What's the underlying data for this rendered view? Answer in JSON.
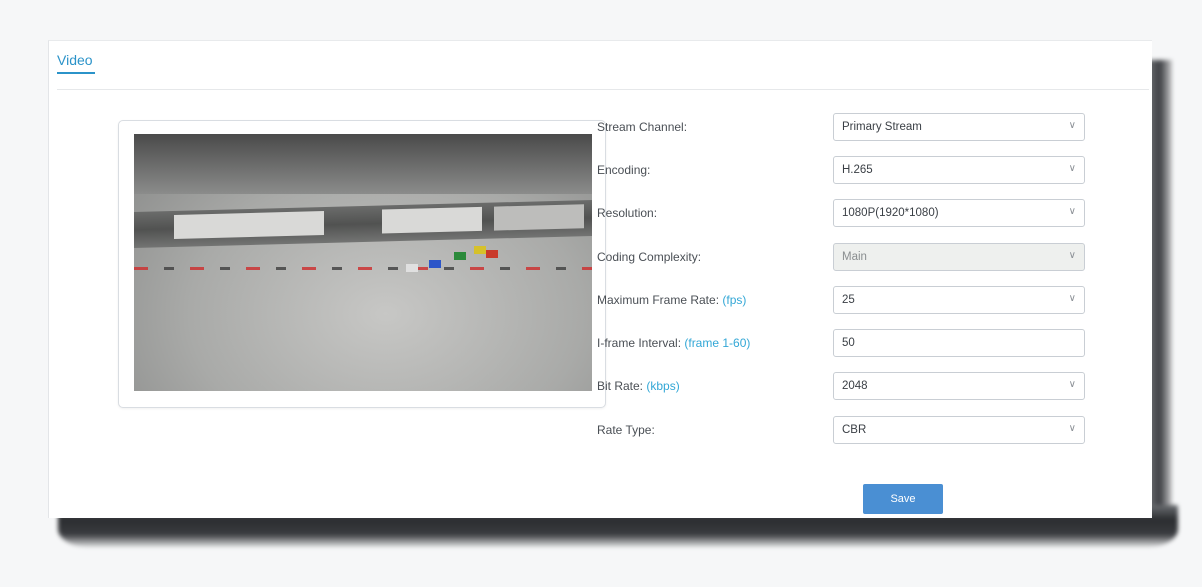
{
  "tab": {
    "title": "Video"
  },
  "preview": {
    "osd_top_left": "",
    "osd_top_right": "",
    "osd_lines": [],
    "osd_text_color": "#e2cf3a"
  },
  "form": {
    "rows": [
      {
        "label": "Stream Channel:",
        "unit": "",
        "value": "Primary Stream",
        "type": "select",
        "disabled": false
      },
      {
        "label": "Encoding:",
        "unit": "",
        "value": "H.265",
        "type": "select",
        "disabled": false
      },
      {
        "label": "Resolution:",
        "unit": "",
        "value": "1080P(1920*1080)",
        "type": "select",
        "disabled": false
      },
      {
        "label": "Coding Complexity:",
        "unit": "",
        "value": "Main",
        "type": "select",
        "disabled": true
      },
      {
        "label": "Maximum Frame Rate: ",
        "unit": "(fps)",
        "value": "25",
        "type": "select",
        "disabled": false
      },
      {
        "label": "I-frame Interval: ",
        "unit": "(frame 1-60)",
        "value": "50",
        "type": "input",
        "disabled": false
      },
      {
        "label": "Bit Rate: ",
        "unit": "(kbps)",
        "value": "2048",
        "type": "select",
        "disabled": false
      },
      {
        "label": "Rate Type:",
        "unit": "",
        "value": "CBR",
        "type": "select",
        "disabled": false
      }
    ],
    "chevron_icon": "chevron-down-icon"
  },
  "actions": {
    "save_label": "Save"
  },
  "colors": {
    "accent": "#2b93c9",
    "unit_text": "#33a7d6",
    "save_button": "#4a8fd3"
  }
}
